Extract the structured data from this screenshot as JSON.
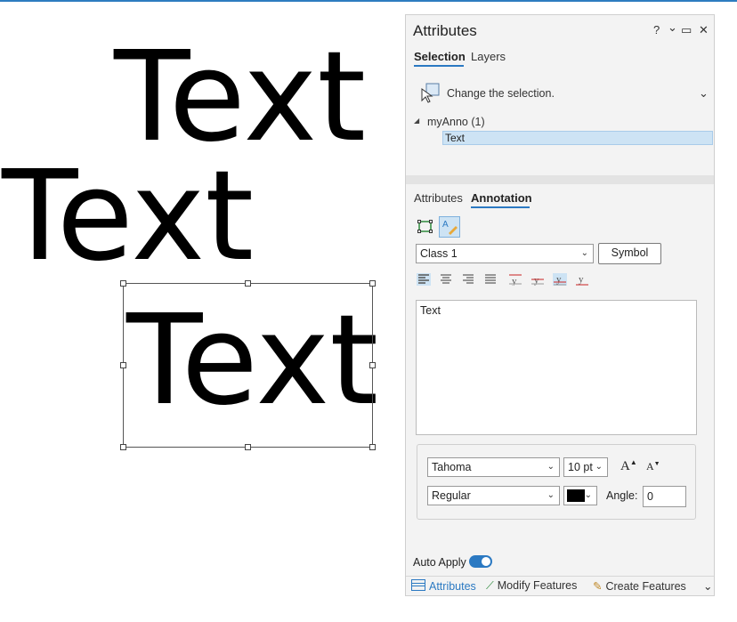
{
  "map": {
    "texts": [
      "Text",
      "Text",
      "Text"
    ]
  },
  "panel": {
    "title": "Attributes",
    "help": "?",
    "options": "⌄",
    "maximize": "▭",
    "close": "✕",
    "top_tabs": [
      "Selection",
      "Layers"
    ],
    "change_selection": "Change the selection.",
    "layer_name": "myAnno (1)",
    "selected_item": "Text",
    "sub_tabs": [
      "Attributes",
      "Annotation"
    ],
    "class_value": "Class 1",
    "symbol_button": "Symbol",
    "text_content": "Text",
    "font_name": "Tahoma",
    "font_size": "10 pt",
    "font_style": "Regular",
    "angle_label": "Angle:",
    "angle_value": "0",
    "grow_font_glyph": "A",
    "shrink_font_glyph": "A",
    "auto_apply_label": "Auto Apply",
    "auto_apply_on": true,
    "bottom_tabs": [
      "Attributes",
      "Modify Features",
      "Create Features"
    ],
    "colors": {
      "accent": "#2b79c2",
      "font_color": "#000000"
    }
  }
}
